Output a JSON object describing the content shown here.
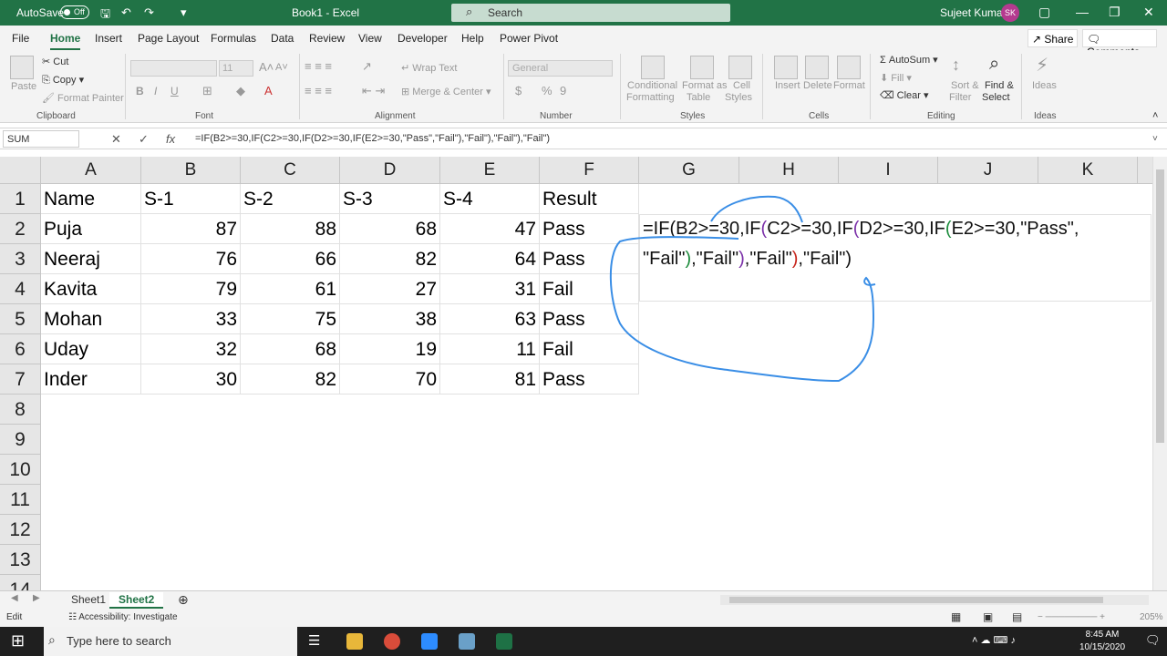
{
  "titlebar": {
    "autosave_label": "AutoSave",
    "autosave_state": "Off",
    "title": "Book1 - Excel",
    "search_placeholder": "Search",
    "user_name": "Sujeet Kumar",
    "user_initials": "SK"
  },
  "menu": {
    "tabs": [
      "File",
      "Home",
      "Insert",
      "Page Layout",
      "Formulas",
      "Data",
      "Review",
      "View",
      "Developer",
      "Help",
      "Power Pivot"
    ],
    "active_tab": "Home",
    "share": "Share",
    "comments": "Comments"
  },
  "ribbon": {
    "clipboard": {
      "paste": "Paste",
      "cut": "Cut",
      "copy": "Copy",
      "format_painter": "Format Painter",
      "label": "Clipboard"
    },
    "font": {
      "font_size": "11",
      "bold": "B",
      "italic": "I",
      "underline": "U",
      "label": "Font"
    },
    "alignment": {
      "wrap_text": "Wrap Text",
      "merge_center": "Merge & Center",
      "label": "Alignment"
    },
    "number": {
      "format": "General",
      "currency": "$",
      "percent": "%",
      "comma": "9",
      "label": "Number"
    },
    "styles": {
      "conditional": "Conditional",
      "formatting": "Formatting",
      "format_as": "Format as",
      "table": "Table",
      "cell": "Cell",
      "cell_styles": "Styles",
      "label": "Styles"
    },
    "cells": {
      "insert": "Insert",
      "delete": "Delete",
      "format": "Format",
      "label": "Cells"
    },
    "editing": {
      "autosum": "AutoSum",
      "fill": "Fill",
      "clear": "Clear",
      "sort": "Sort &",
      "filter": "Filter",
      "find": "Find &",
      "select": "Select",
      "label": "Editing"
    },
    "ideas": {
      "ideas": "Ideas",
      "label": "Ideas"
    }
  },
  "formula_bar": {
    "name_box": "SUM",
    "fx": "fx",
    "formula": "=IF(B2>=30,IF(C2>=30,IF(D2>=30,IF(E2>=30,\"Pass\",\"Fail\"),\"Fail\"),\"Fail\"),\"Fail\")"
  },
  "sheet": {
    "columns": [
      "A",
      "B",
      "C",
      "D",
      "E",
      "F",
      "G",
      "H",
      "I",
      "J",
      "K"
    ],
    "row_numbers": [
      "1",
      "2",
      "3",
      "4",
      "5",
      "6",
      "7",
      "8",
      "9",
      "10",
      "11",
      "12",
      "13",
      "14"
    ],
    "rows": [
      [
        "Name",
        "S-1",
        "S-2",
        "S-3",
        "S-4",
        "Result"
      ],
      [
        "Puja",
        "87",
        "88",
        "68",
        "47",
        "Pass"
      ],
      [
        "Neeraj",
        "76",
        "66",
        "82",
        "64",
        "Pass"
      ],
      [
        "Kavita",
        "79",
        "61",
        "27",
        "31",
        "Fail"
      ],
      [
        "Mohan",
        "33",
        "75",
        "38",
        "63",
        "Pass"
      ],
      [
        "Uday",
        "32",
        "68",
        "19",
        "11",
        "Fail"
      ],
      [
        "Inder",
        "30",
        "82",
        "70",
        "81",
        "Pass"
      ]
    ],
    "edit_line1": {
      "a": "=IF(B2>=30,IF",
      "b": "(",
      "c": "C2>=30,IF",
      "d": "(",
      "e": "D2>=30,IF",
      "f": "(",
      "g": "E2>=30,\"Pass\","
    },
    "edit_line2": {
      "a": "\"Fail\"",
      "b": ")",
      "c": ",\"Fail\"",
      "d": ")",
      "e": ",\"Fail\"",
      "f": ")",
      "g": ",\"Fail\")"
    }
  },
  "sheet_tabs": [
    "Sheet1",
    "Sheet2"
  ],
  "active_sheet": "Sheet2",
  "status": {
    "mode": "Edit",
    "accessibility": "Accessibility: Investigate",
    "zoom": "205%"
  },
  "taskbar": {
    "search_placeholder": "Type here to search",
    "time": "8:45 AM",
    "date": "10/15/2020"
  },
  "colors": {
    "excel_green": "#217346",
    "annotation_blue": "#3a8ee6"
  }
}
